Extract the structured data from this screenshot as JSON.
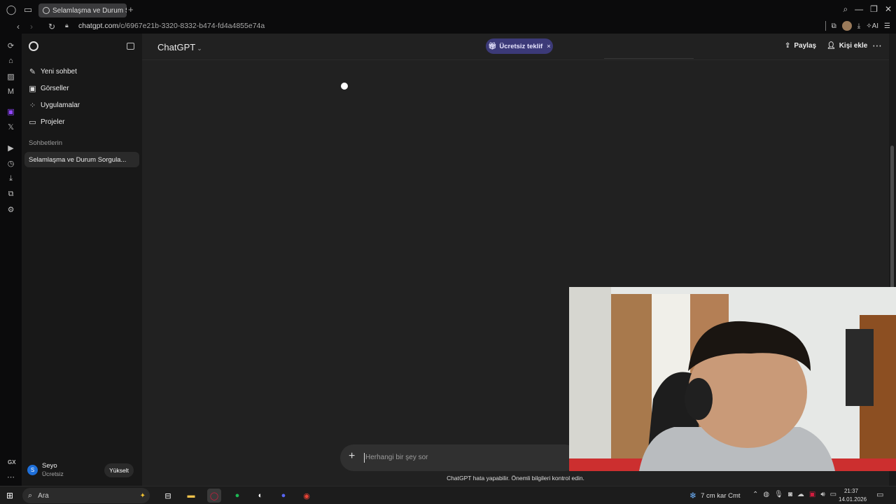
{
  "browser": {
    "tab_title": "Selamlaşma ve Durum Sorgula",
    "url_host": "chatgpt.com",
    "url_path": "/c/6967e21b-3320-8332-b474-fd4a4855e74a",
    "ai_label": "AI"
  },
  "sidebar": {
    "items": [
      {
        "label": "Yeni sohbet",
        "icon": "edit-icon"
      },
      {
        "label": "Görseller",
        "icon": "image-icon"
      },
      {
        "label": "Uygulamalar",
        "icon": "apps-icon"
      },
      {
        "label": "Projeler",
        "icon": "folder-icon"
      }
    ],
    "section_title": "Sohbetlerin",
    "chats": [
      "Selamlaşma ve Durum Sorgula..."
    ],
    "user": {
      "initial": "S",
      "name": "Seyo",
      "plan": "Ücretsiz"
    },
    "upgrade_label": "Yükselt"
  },
  "header": {
    "model": "ChatGPT",
    "offer": "Ücretsiz teklif",
    "offer_close": "×",
    "share": "Paylaş",
    "add_user": "Kişi ekle"
  },
  "composer": {
    "placeholder": "Herhangi bir şey sor"
  },
  "disclaimer": "ChatGPT hata yapabilir. Önemli bilgileri kontrol edin.",
  "taskbar": {
    "search": "Ara",
    "weather": "7 cm kar Cmt",
    "time": "21:37",
    "date": "14.01.2026"
  },
  "colors": {
    "offer_bg": "#3c3a78",
    "main_bg": "#212121",
    "sidebar_bg": "#181818"
  }
}
